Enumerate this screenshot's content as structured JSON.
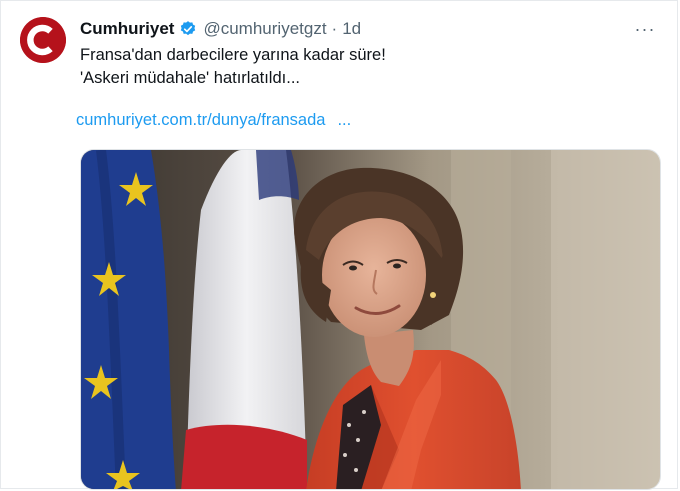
{
  "tweet": {
    "author_name": "Cumhuriyet",
    "handle": "@cumhuriyetgzt",
    "separator": "·",
    "time": "1d",
    "text_line1": "Fransa'dan darbecilere yarına kadar süre!",
    "text_line2": "'Askeri müdahale' hatırlatıldı...",
    "link_text": "cumhuriyet.com.tr/dunya/fransada",
    "link_ellipsis": "...",
    "more_label": "···"
  },
  "icons": {
    "avatar": "cumhuriyet-logo",
    "verified": "verified-badge-icon",
    "more": "more-options-icon"
  },
  "colors": {
    "brand_red": "#b5121b",
    "link_blue": "#1d9bf0",
    "verified_blue": "#1d9bf0",
    "secondary_text": "#536471",
    "jacket": "#e0502f",
    "eu_blue": "#1f3d8f",
    "eu_star": "#e9c41f"
  }
}
